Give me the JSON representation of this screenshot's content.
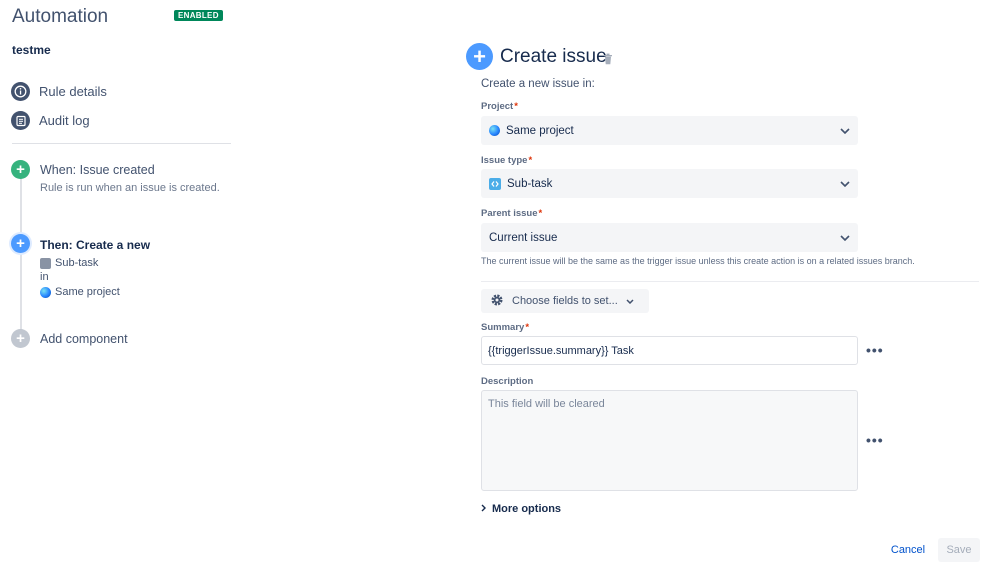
{
  "app": {
    "title": "Automation",
    "status_badge": "ENABLED"
  },
  "rule": {
    "name": "testme"
  },
  "nav": [
    {
      "label": "Rule details",
      "icon": "info-icon"
    },
    {
      "label": "Audit log",
      "icon": "audit-log-icon"
    }
  ],
  "steps": {
    "trigger": {
      "title": "When: Issue created",
      "subtitle": "Rule is run when an issue is created."
    },
    "action": {
      "title": "Then: Create a new",
      "line1": "Sub-task",
      "line2": "in",
      "line3": "Same project"
    },
    "add_component": "Add component"
  },
  "editor": {
    "title": "Create issue",
    "intro": "Create a new issue in:",
    "project": {
      "label": "Project",
      "value": "Same project"
    },
    "issue_type": {
      "label": "Issue type",
      "value": "Sub-task"
    },
    "parent_issue": {
      "label": "Parent issue",
      "value": "Current issue",
      "helper": "The current issue will be the same as the trigger issue unless this create action is on a related issues branch."
    },
    "choose_fields": "Choose fields to set...",
    "summary": {
      "label": "Summary",
      "value": "{{triggerIssue.summary}} Task"
    },
    "description": {
      "label": "Description",
      "placeholder": "This field will be cleared"
    },
    "more_options": "More options",
    "cancel": "Cancel",
    "save": "Save",
    "required_marker": "*"
  },
  "colors": {
    "enabled": "#00875a",
    "trigger": "#36b37e",
    "action": "#4c9aff",
    "add": "#c1c7d0",
    "link": "#0052cc",
    "required": "#de350b"
  }
}
